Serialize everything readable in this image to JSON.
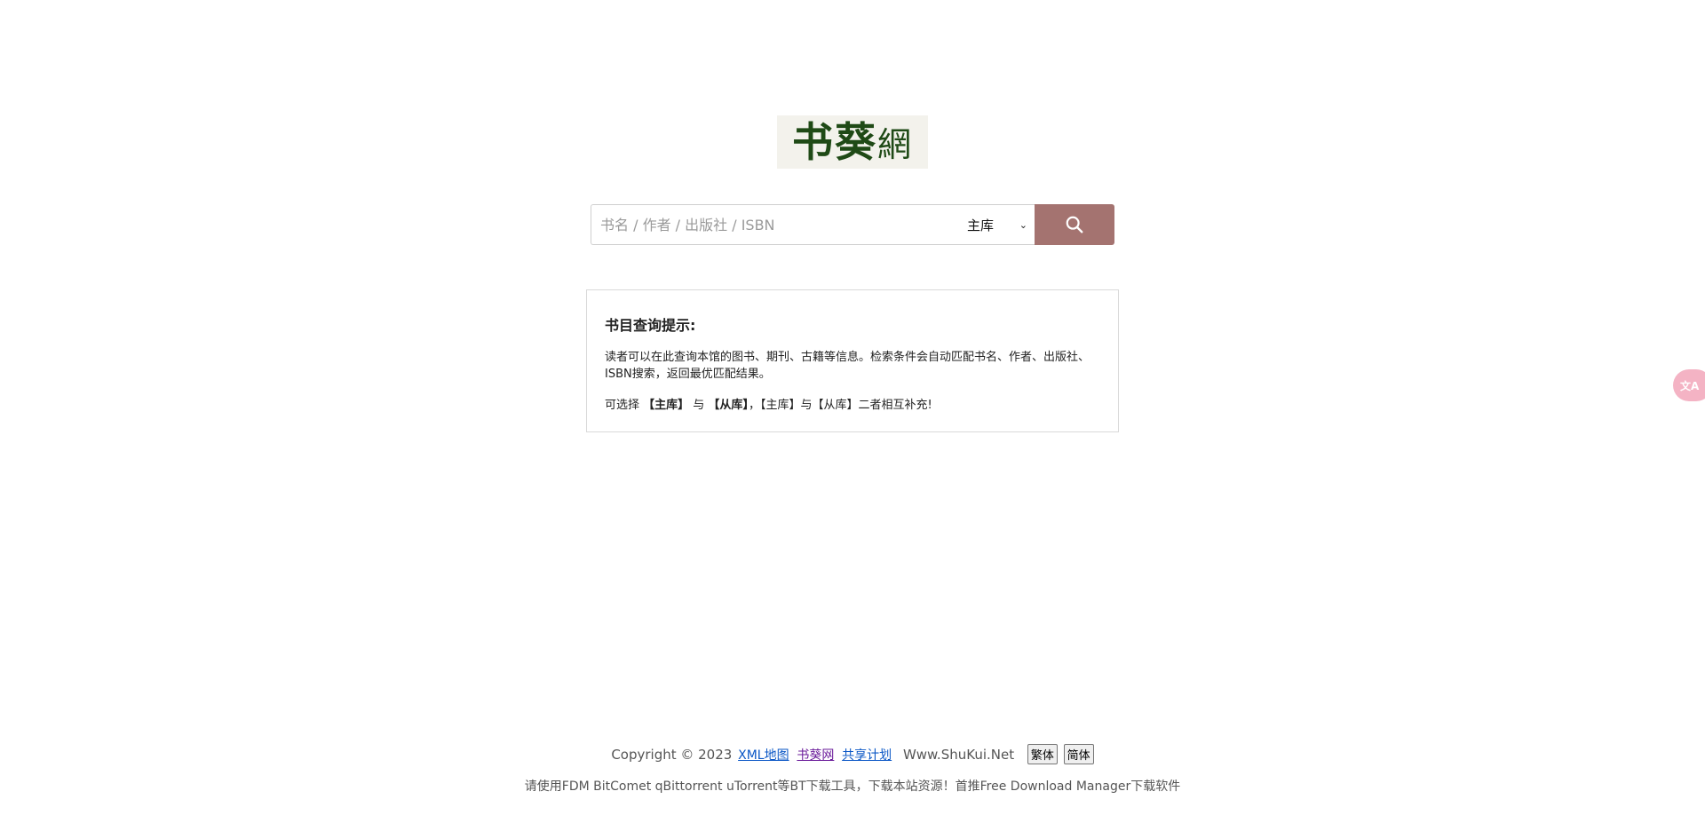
{
  "logo": {
    "text_main": "书葵",
    "text_small": "網"
  },
  "search": {
    "placeholder": "书名 / 作者 / 出版社 / ISBN",
    "scope_selected": "主库",
    "button_icon": "search-icon"
  },
  "tips": {
    "title": "书目查询提示:",
    "body": "读者可以在此查询本馆的图书、期刊、古籍等信息。检索条件会自动匹配书名、作者、出版社、ISBN搜索，返回最优匹配结果。",
    "note_prefix": "可选择 ",
    "note_main": "【主库】",
    "note_and": " 与 ",
    "note_secondary": "【从库】",
    "note_suffix": "，【主库】与【从库】二者相互补充!"
  },
  "footer": {
    "copyright": "Copyright © 2023",
    "links": [
      "XML地图",
      "书葵网",
      "共享计划"
    ],
    "site": "Www.ShuKui.Net",
    "lang_traditional": "繁体",
    "lang_simplified": "简体",
    "notice": "请使用FDM BitComet qBittorrent uTorrent等BT下载工具，下载本站资源！首推Free Download Manager下载软件"
  },
  "translate_widget": {
    "label": "文A"
  },
  "colors": {
    "search_button": "#a47370",
    "logo_text": "#1f4a16",
    "logo_bg": "#f3f2ec",
    "link_blue": "#0b57c6",
    "link_visited": "#6a1b9a",
    "translate_widget": "#f4b3c4"
  }
}
